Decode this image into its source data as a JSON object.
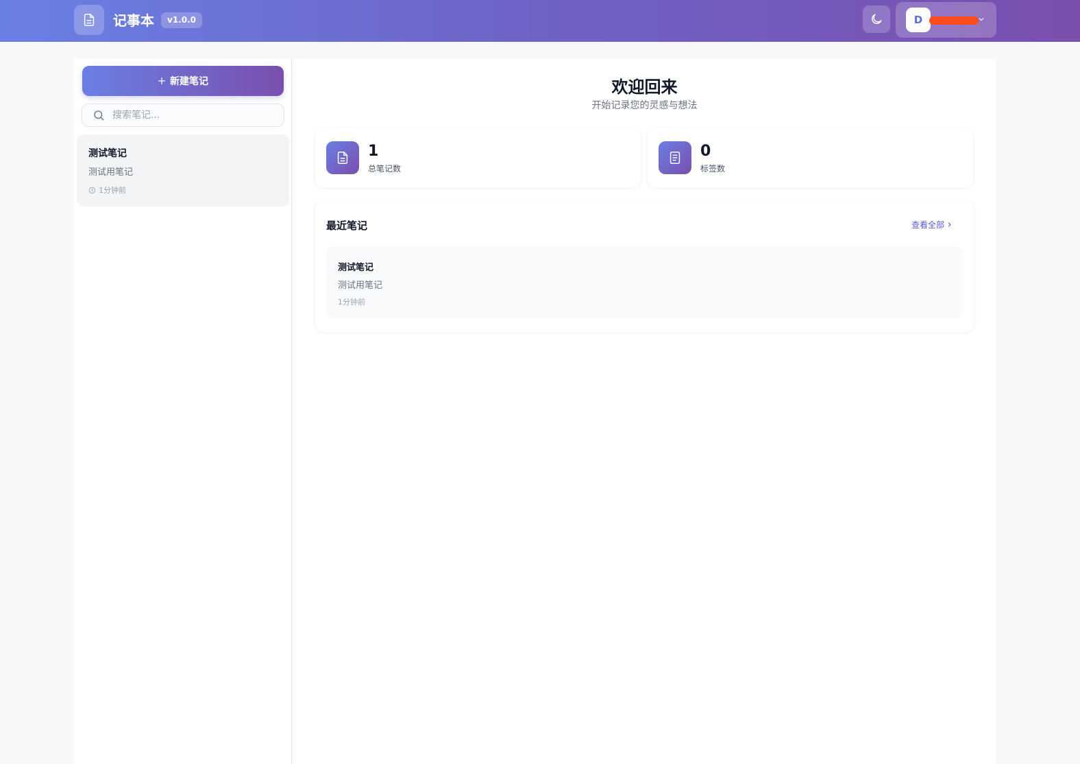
{
  "header": {
    "app_title": "记事本",
    "version": "v1.0.0",
    "user_initial": "D",
    "user_name": "",
    "accent_gradient": [
      "#6a7fe4",
      "#7a4fae"
    ]
  },
  "sidebar": {
    "new_note_label": "新建笔记",
    "search_placeholder": "搜索笔记...",
    "notes": [
      {
        "title": "测试笔记",
        "desc": "测试用笔记",
        "time": "1分钟前"
      }
    ]
  },
  "main": {
    "welcome_title": "欢迎回来",
    "welcome_sub": "开始记录您的灵感与想法",
    "stats": [
      {
        "value": "1",
        "label": "总笔记数",
        "icon": "document-icon"
      },
      {
        "value": "0",
        "label": "标签数",
        "icon": "list-doc-icon"
      }
    ],
    "recent": {
      "title": "最近笔记",
      "view_all": "查看全部",
      "items": [
        {
          "title": "测试笔记",
          "desc": "测试用笔记",
          "time": "1分钟前"
        }
      ]
    }
  }
}
